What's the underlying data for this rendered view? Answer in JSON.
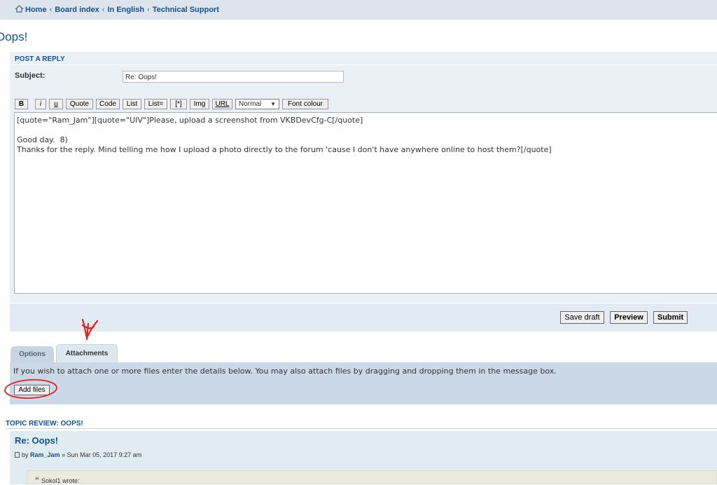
{
  "breadcrumb": {
    "items": [
      "Home",
      "Board index",
      "In English",
      "Technical Support"
    ],
    "separator": "‹"
  },
  "page_title": "Oops!",
  "post_form": {
    "heading": "POST A REPLY",
    "subject_label": "Subject:",
    "subject_value": "Re: Oops!",
    "toolbar": {
      "bold": "B",
      "italic": "i",
      "underline": "u",
      "quote": "Quote",
      "code": "Code",
      "list": "List",
      "list_ordered": "List=",
      "list_item": "[*]",
      "img": "Img",
      "url": "URL",
      "font_size": "Normal",
      "font_colour": "Font colour"
    },
    "message": "[quote=\"Ram_Jam\"][quote=\"UIV\"]Please, upload a screenshot from VKBDevCfg-C[/quote]\n\nGood day.  8)\nThanks for the reply. Mind telling me how I upload a photo directly to the forum 'cause I don't have anywhere online to host them?[/quote]",
    "buttons": {
      "save_draft": "Save draft",
      "preview": "Preview",
      "submit": "Submit"
    }
  },
  "tabs": {
    "options": "Options",
    "attachments": "Attachments"
  },
  "attachments": {
    "instructions": "If you wish to attach one or more files enter the details below. You may also attach files by dragging and dropping them in the message box.",
    "add_files": "Add files"
  },
  "topic_review": {
    "heading": "TOPIC REVIEW: OOPS!",
    "post_title": "Re: Oops!",
    "meta_by": "by",
    "author": "Ram_Jam",
    "date": "» Sun Mar 05, 2017 9:27 am",
    "quote_cite": "Sokol1 wrote:"
  },
  "colors": {
    "link": "#105289",
    "panel_bg": "#eaf0f6",
    "annotation": "#e0201e"
  }
}
